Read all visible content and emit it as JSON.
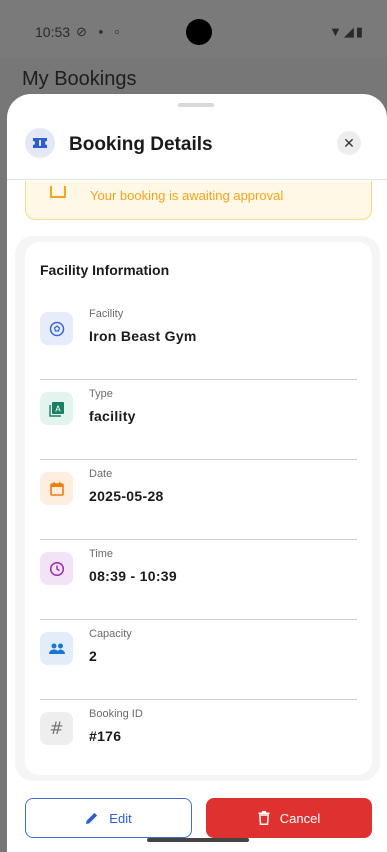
{
  "status_bar": {
    "time": "10:53"
  },
  "background_page": {
    "title": "My Bookings"
  },
  "sheet": {
    "title": "Booking Details",
    "status_message": "Your booking is awaiting approval",
    "section_title": "Facility Information",
    "rows": [
      {
        "label": "Facility",
        "value": "Iron Beast Gym",
        "icon": "soccer-ball-icon"
      },
      {
        "label": "Type",
        "value": "facility",
        "icon": "category-icon"
      },
      {
        "label": "Date",
        "value": "2025-05-28",
        "icon": "calendar-icon"
      },
      {
        "label": "Time",
        "value": "08:39 - 10:39",
        "icon": "clock-icon"
      },
      {
        "label": "Capacity",
        "value": "2",
        "icon": "people-icon"
      },
      {
        "label": "Booking ID",
        "value": "#176",
        "icon": "hash-icon"
      }
    ]
  },
  "actions": {
    "edit_label": "Edit",
    "cancel_label": "Cancel"
  },
  "colors": {
    "primary": "#2d5ed0",
    "danger": "#e03131",
    "warning": "#f2a31c"
  }
}
